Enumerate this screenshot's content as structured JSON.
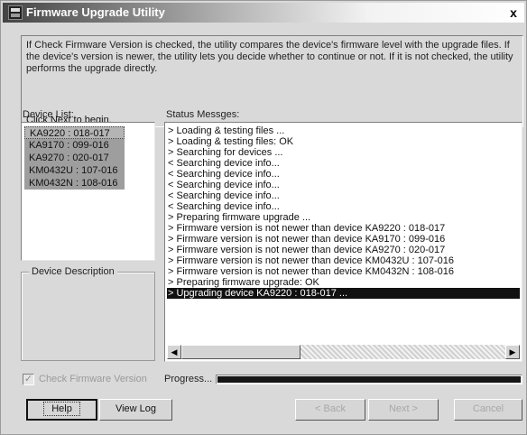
{
  "window": {
    "title": "Firmware Upgrade Utility",
    "close_label": "x"
  },
  "info": {
    "text": "If Check Firmware Version is checked, the utility compares the device's firmware level with the upgrade files. If the device's version is newer, the utility lets you decide whether to continue or not. If it is not checked, the utility performs the upgrade directly.",
    "next_hint": "Click Next to begin."
  },
  "device_list": {
    "label": "Device List:",
    "items": [
      "KA9220 : 018-017",
      "KA9170 : 099-016",
      "KA9270 : 020-017",
      "KM0432U : 107-016",
      "KM0432N : 108-016"
    ]
  },
  "device_description": {
    "label": "Device Description"
  },
  "status": {
    "label": "Status Messges:",
    "selected_index": 17,
    "lines": [
      "> Loading & testing files ...",
      "> Loading & testing files: OK",
      "> Searching for devices ...",
      "< Searching device info...",
      "< Searching device info...",
      "< Searching device info...",
      "< Searching device info...",
      "< Searching device info...",
      "> Preparing firmware upgrade ...",
      "> Firmware version is not newer than device KA9220 : 018-017",
      "> Firmware version is not newer than device KA9170 : 099-016",
      "> Firmware version is not newer than device KA9270 : 020-017",
      "> Firmware version is not newer than device KM0432U : 107-016",
      "> Firmware version is not newer than device KM0432N : 108-016",
      "> Preparing firmware upgrade: OK",
      "> Upgrading device KA9220 : 018-017 ..."
    ]
  },
  "check_firmware": {
    "label": "Check Firmware Version",
    "checked": true,
    "mark": "✓"
  },
  "progress": {
    "label": "Progress...",
    "fraction": 1.0
  },
  "buttons": {
    "help": "Help",
    "view_log": "View Log",
    "back": "< Back",
    "next": "Next >",
    "cancel": "Cancel"
  },
  "scroll": {
    "left": "◀",
    "right": "▶"
  }
}
